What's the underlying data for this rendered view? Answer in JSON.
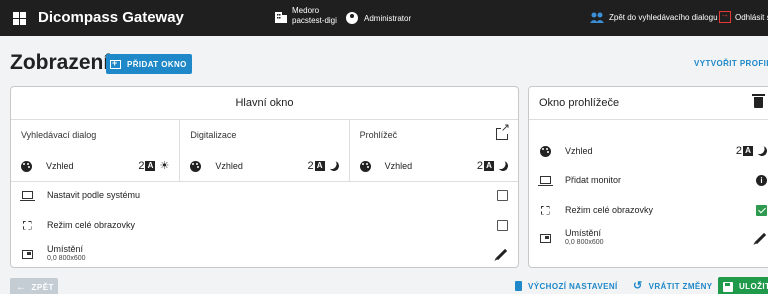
{
  "header": {
    "app_title": "Dicompass Gateway",
    "server_name": "Medoro",
    "server_host": "pacstest-digi",
    "user": "Administrator",
    "back_to_search": "Zpět do vyhledávacího dialogu",
    "logout": "Odhlásit se"
  },
  "page": {
    "title": "Zobrazení",
    "add_window_label": "PŘIDAT OKNO",
    "create_profile_label": "VYTVOŘIT PROFIL"
  },
  "main_window": {
    "title": "Hlavní okno",
    "columns": [
      {
        "title": "Vyhledávací dialog",
        "appearance_label": "Vzhled",
        "font_size": "2",
        "theme": "light",
        "theme_icon": "sun-icon"
      },
      {
        "title": "Digitalizace",
        "appearance_label": "Vzhled",
        "font_size": "2",
        "theme": "dark",
        "theme_icon": "moon-icon"
      },
      {
        "title": "Prohlížeč",
        "appearance_label": "Vzhled",
        "font_size": "2",
        "theme": "dark",
        "theme_icon": "moon-icon"
      }
    ],
    "system_option_label": "Nastavit podle systému",
    "system_option_checked": false,
    "fullscreen_label": "Režim celé obrazovky",
    "fullscreen_checked": false,
    "placement_label": "Umístění",
    "placement_value": "0,0 800x600"
  },
  "viewer_window": {
    "title": "Okno prohlížeče",
    "appearance_label": "Vzhled",
    "font_size": "2",
    "theme": "dark",
    "add_monitor_label": "Přidat monitor",
    "fullscreen_label": "Režim celé obrazovky",
    "fullscreen_checked": true,
    "placement_label": "Umístění",
    "placement_value": "0,0 800x600"
  },
  "footer": {
    "back_label": "ZPĚT",
    "defaults_label": "VÝCHOZÍ NASTAVENÍ",
    "revert_label": "VRÁTIT ZMĚNY",
    "save_label": "ULOŽIT"
  },
  "colors": {
    "accent": "#1e88c8",
    "save": "#1f9a4a",
    "header_bg": "#1f1f1f",
    "logout_icon": "#e53935"
  }
}
